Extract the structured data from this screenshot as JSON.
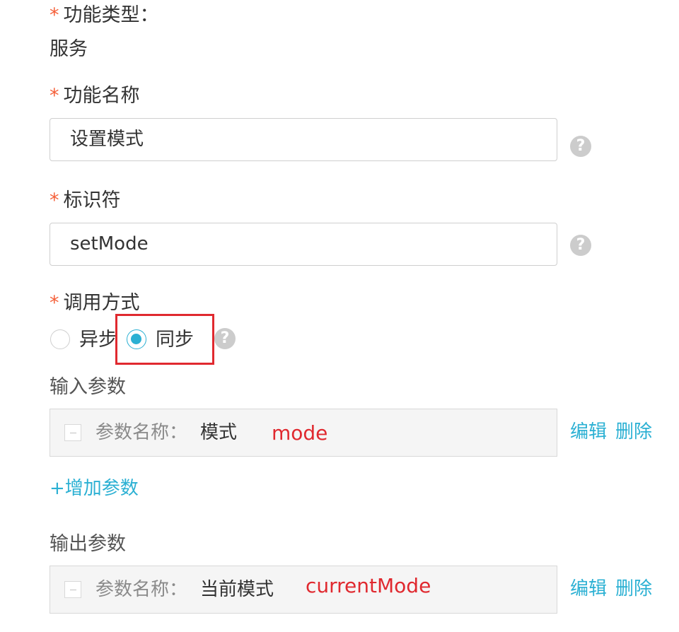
{
  "function_type": {
    "required_mark": "*",
    "label": "功能类型：",
    "value": "服务"
  },
  "function_name": {
    "required_mark": "*",
    "label": "功能名称",
    "value": "设置模式",
    "help": "?"
  },
  "identifier": {
    "required_mark": "*",
    "label": "标识符",
    "value": "setMode",
    "help": "?"
  },
  "call_mode": {
    "required_mark": "*",
    "label": "调用方式",
    "options": [
      {
        "label": "异步",
        "checked": false
      },
      {
        "label": "同步",
        "checked": true
      }
    ],
    "help": "?"
  },
  "input_params": {
    "label": "输入参数",
    "items": [
      {
        "param_label": "参数名称：",
        "name": "模式",
        "annotation": "mode",
        "edit": "编辑",
        "delete": "删除"
      }
    ],
    "add_label": "+增加参数"
  },
  "output_params": {
    "label": "输出参数",
    "items": [
      {
        "param_label": "参数名称：",
        "name": "当前模式",
        "annotation": "currentMode",
        "edit": "编辑",
        "delete": "删除"
      }
    ]
  },
  "colors": {
    "accent": "#2bb0d3",
    "required": "#f5603a",
    "annotation": "#e0292f"
  }
}
